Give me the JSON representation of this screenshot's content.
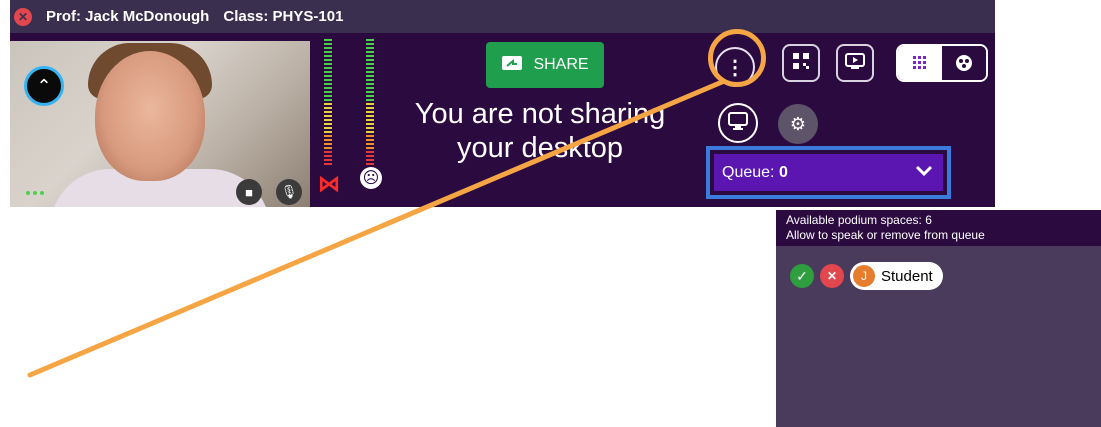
{
  "title_bar": {
    "prof": "Prof: Jack McDonough",
    "class": "Class: PHYS-101"
  },
  "share": {
    "button_label": "SHARE",
    "message_line1": "You are not sharing",
    "message_line2": "your desktop"
  },
  "queue": {
    "label": "Queue: ",
    "count": "0"
  },
  "podium": {
    "available_line": "Available podium spaces: 6",
    "instruction_line": "Allow to speak or remove from queue",
    "students": [
      {
        "initial": "J",
        "name": "Student"
      }
    ]
  },
  "colors": {
    "primary_bg": "#2a0a3f",
    "share_green": "#1f9e4d",
    "queue_purple": "#5b15b0",
    "highlight_orange": "#f6a544",
    "highlight_blue": "#3a7bdb"
  }
}
